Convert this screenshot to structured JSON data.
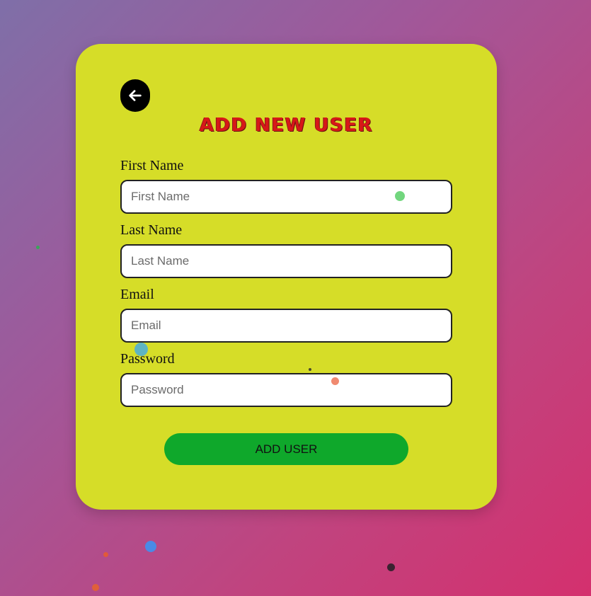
{
  "page": {
    "background_colors": [
      "#7f6fa8",
      "#a0589a",
      "#c0447f",
      "#d4306e"
    ]
  },
  "form": {
    "back_icon": "arrow-left-icon",
    "title": "ADD NEW USER",
    "fields": [
      {
        "label": "First Name",
        "placeholder": "First Name",
        "value": ""
      },
      {
        "label": "Last Name",
        "placeholder": "Last Name",
        "value": ""
      },
      {
        "label": "Email",
        "placeholder": "Email",
        "value": ""
      },
      {
        "label": "Password",
        "placeholder": "Password",
        "value": ""
      }
    ],
    "submit_label": "ADD USER",
    "colors": {
      "card": "#d6dd28",
      "title": "#d71818",
      "submit": "#0fa82b",
      "back_button": "#000000"
    }
  }
}
